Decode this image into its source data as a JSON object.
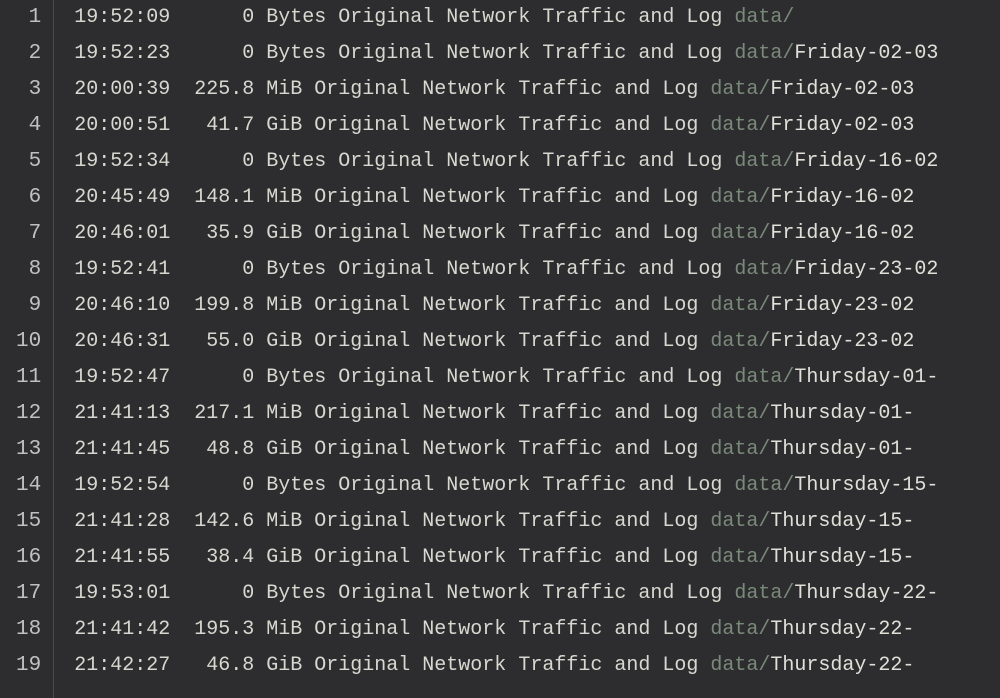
{
  "lines": [
    {
      "num": "1",
      "time": "19:52:09",
      "size": "      0 Bytes",
      "label": "Original Network Traffic and Log ",
      "pathPrefix": "data/",
      "pathName": ""
    },
    {
      "num": "2",
      "time": "19:52:23",
      "size": "      0 Bytes",
      "label": "Original Network Traffic and Log ",
      "pathPrefix": "data/",
      "pathName": "Friday-02-03"
    },
    {
      "num": "3",
      "time": "20:00:39",
      "size": "  225.8 MiB",
      "label": "Original Network Traffic and Log ",
      "pathPrefix": "data/",
      "pathName": "Friday-02-03"
    },
    {
      "num": "4",
      "time": "20:00:51",
      "size": "   41.7 GiB",
      "label": "Original Network Traffic and Log ",
      "pathPrefix": "data/",
      "pathName": "Friday-02-03"
    },
    {
      "num": "5",
      "time": "19:52:34",
      "size": "      0 Bytes",
      "label": "Original Network Traffic and Log ",
      "pathPrefix": "data/",
      "pathName": "Friday-16-02"
    },
    {
      "num": "6",
      "time": "20:45:49",
      "size": "  148.1 MiB",
      "label": "Original Network Traffic and Log ",
      "pathPrefix": "data/",
      "pathName": "Friday-16-02"
    },
    {
      "num": "7",
      "time": "20:46:01",
      "size": "   35.9 GiB",
      "label": "Original Network Traffic and Log ",
      "pathPrefix": "data/",
      "pathName": "Friday-16-02"
    },
    {
      "num": "8",
      "time": "19:52:41",
      "size": "      0 Bytes",
      "label": "Original Network Traffic and Log ",
      "pathPrefix": "data/",
      "pathName": "Friday-23-02"
    },
    {
      "num": "9",
      "time": "20:46:10",
      "size": "  199.8 MiB",
      "label": "Original Network Traffic and Log ",
      "pathPrefix": "data/",
      "pathName": "Friday-23-02"
    },
    {
      "num": "10",
      "time": "20:46:31",
      "size": "   55.0 GiB",
      "label": "Original Network Traffic and Log ",
      "pathPrefix": "data/",
      "pathName": "Friday-23-02"
    },
    {
      "num": "11",
      "time": "19:52:47",
      "size": "      0 Bytes",
      "label": "Original Network Traffic and Log ",
      "pathPrefix": "data/",
      "pathName": "Thursday-01-"
    },
    {
      "num": "12",
      "time": "21:41:13",
      "size": "  217.1 MiB",
      "label": "Original Network Traffic and Log ",
      "pathPrefix": "data/",
      "pathName": "Thursday-01-"
    },
    {
      "num": "13",
      "time": "21:41:45",
      "size": "   48.8 GiB",
      "label": "Original Network Traffic and Log ",
      "pathPrefix": "data/",
      "pathName": "Thursday-01-"
    },
    {
      "num": "14",
      "time": "19:52:54",
      "size": "      0 Bytes",
      "label": "Original Network Traffic and Log ",
      "pathPrefix": "data/",
      "pathName": "Thursday-15-"
    },
    {
      "num": "15",
      "time": "21:41:28",
      "size": "  142.6 MiB",
      "label": "Original Network Traffic and Log ",
      "pathPrefix": "data/",
      "pathName": "Thursday-15-"
    },
    {
      "num": "16",
      "time": "21:41:55",
      "size": "   38.4 GiB",
      "label": "Original Network Traffic and Log ",
      "pathPrefix": "data/",
      "pathName": "Thursday-15-"
    },
    {
      "num": "17",
      "time": "19:53:01",
      "size": "      0 Bytes",
      "label": "Original Network Traffic and Log ",
      "pathPrefix": "data/",
      "pathName": "Thursday-22-"
    },
    {
      "num": "18",
      "time": "21:41:42",
      "size": "  195.3 MiB",
      "label": "Original Network Traffic and Log ",
      "pathPrefix": "data/",
      "pathName": "Thursday-22-"
    },
    {
      "num": "19",
      "time": "21:42:27",
      "size": "   46.8 GiB",
      "label": "Original Network Traffic and Log ",
      "pathPrefix": "data/",
      "pathName": "Thursday-22-"
    }
  ]
}
